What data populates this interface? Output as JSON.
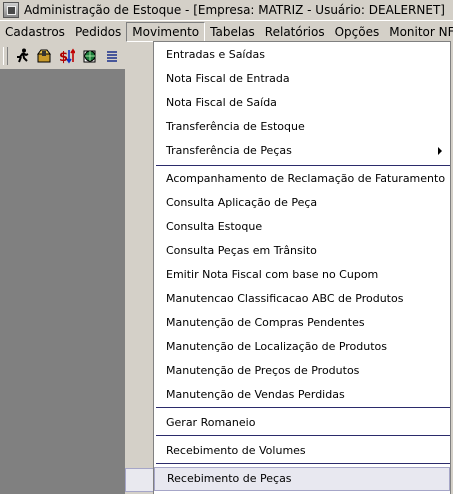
{
  "window": {
    "title": "Administração de Estoque - [Empresa: MATRIZ - Usuário: DEALERNET]"
  },
  "menubar": {
    "items": [
      {
        "label": "Cadastros"
      },
      {
        "label": "Pedidos"
      },
      {
        "label": "Movimento",
        "active": true
      },
      {
        "label": "Tabelas"
      },
      {
        "label": "Relatórios"
      },
      {
        "label": "Opções"
      },
      {
        "label": "Monitor NF-e N"
      }
    ]
  },
  "toolbar": {
    "buttons": [
      {
        "icon": "running-man-icon"
      },
      {
        "icon": "box-icon"
      },
      {
        "icon": "dollar-arrows-icon"
      },
      {
        "icon": "document-globe-icon"
      },
      {
        "icon": "list-icon"
      }
    ]
  },
  "movimento_menu": {
    "items": [
      {
        "label": "Entradas e Saídas"
      },
      {
        "label": "Nota Fiscal de Entrada"
      },
      {
        "label": "Nota Fiscal de Saída"
      },
      {
        "label": "Transferência de Estoque"
      },
      {
        "label": "Transferência de Peças",
        "submenu": true
      },
      {
        "label": "Acompanhamento de Reclamação de Faturamento"
      },
      {
        "label": "Consulta Aplicação de Peça"
      },
      {
        "label": "Consulta Estoque"
      },
      {
        "label": "Consulta Peças em Trânsito"
      },
      {
        "label": "Emitir Nota Fiscal com base no Cupom"
      },
      {
        "label": "Manutencao Classificacao ABC de Produtos"
      },
      {
        "label": "Manutenção de Compras Pendentes"
      },
      {
        "label": "Manutenção de Localização de Produtos"
      },
      {
        "label": "Manutenção de Preços de Produtos"
      },
      {
        "label": "Manutenção de Vendas Perdidas"
      },
      {
        "label": "Gerar Romaneio"
      },
      {
        "label": "Recebimento de Volumes"
      },
      {
        "label": "Recebimento de Peças",
        "selected": true
      }
    ]
  }
}
